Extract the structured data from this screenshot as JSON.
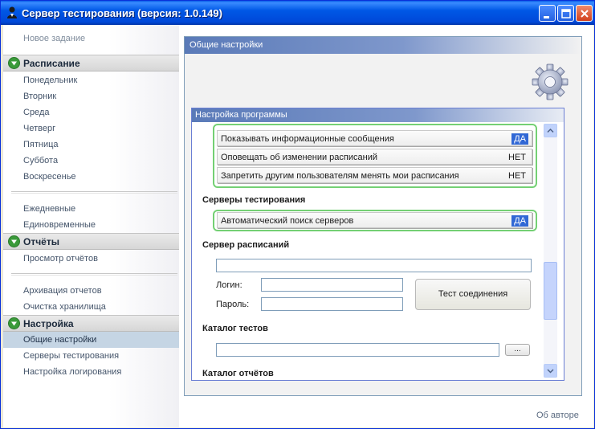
{
  "window": {
    "title": "Сервер тестирования (версия: 1.0.149)"
  },
  "sidebar": {
    "new_task": "Новое задание",
    "schedule_header": "Расписание",
    "days": [
      "Понедельник",
      "Вторник",
      "Среда",
      "Четверг",
      "Пятница",
      "Суббота",
      "Воскресенье"
    ],
    "daily": "Ежедневные",
    "one_time": "Единовременные",
    "reports_header": "Отчёты",
    "view_reports": "Просмотр отчётов",
    "archive_reports": "Архивация отчетов",
    "clear_storage": "Очистка хранилища",
    "settings_header": "Настройка",
    "settings_items": [
      "Общие настройки",
      "Серверы тестирования",
      "Настройка логирования"
    ]
  },
  "main": {
    "header": "Общие настройки",
    "settings_panel_header": "Настройка программы",
    "toggles": [
      {
        "label": "Показывать информационные сообщения",
        "value": "ДА",
        "on": true
      },
      {
        "label": "Оповещать об изменении расписаний",
        "value": "НЕТ",
        "on": false
      },
      {
        "label": "Запретить другим пользователям менять мои расписания",
        "value": "НЕТ",
        "on": false
      }
    ],
    "servers_section": "Серверы тестирования",
    "auto_search": {
      "label": "Автоматический поиск серверов",
      "value": "ДА",
      "on": true
    },
    "schedule_server_section": "Сервер расписаний",
    "schedule_server_value": "",
    "login_label": "Логин:",
    "login_value": "",
    "password_label": "Пароль:",
    "password_value": "",
    "test_button": "Тест соединения",
    "tests_catalog_section": "Каталог тестов",
    "tests_catalog_value": "",
    "browse_button": "...",
    "reports_catalog_section": "Каталог отчётов"
  },
  "footer": {
    "about": "Об авторе"
  },
  "colors": {
    "titlebar": "#0058e6",
    "accent_header": "#5a7ab8",
    "group_border": "#74d074",
    "toggle_on": "#3168d5",
    "selected_item": "#c5d5e4"
  }
}
